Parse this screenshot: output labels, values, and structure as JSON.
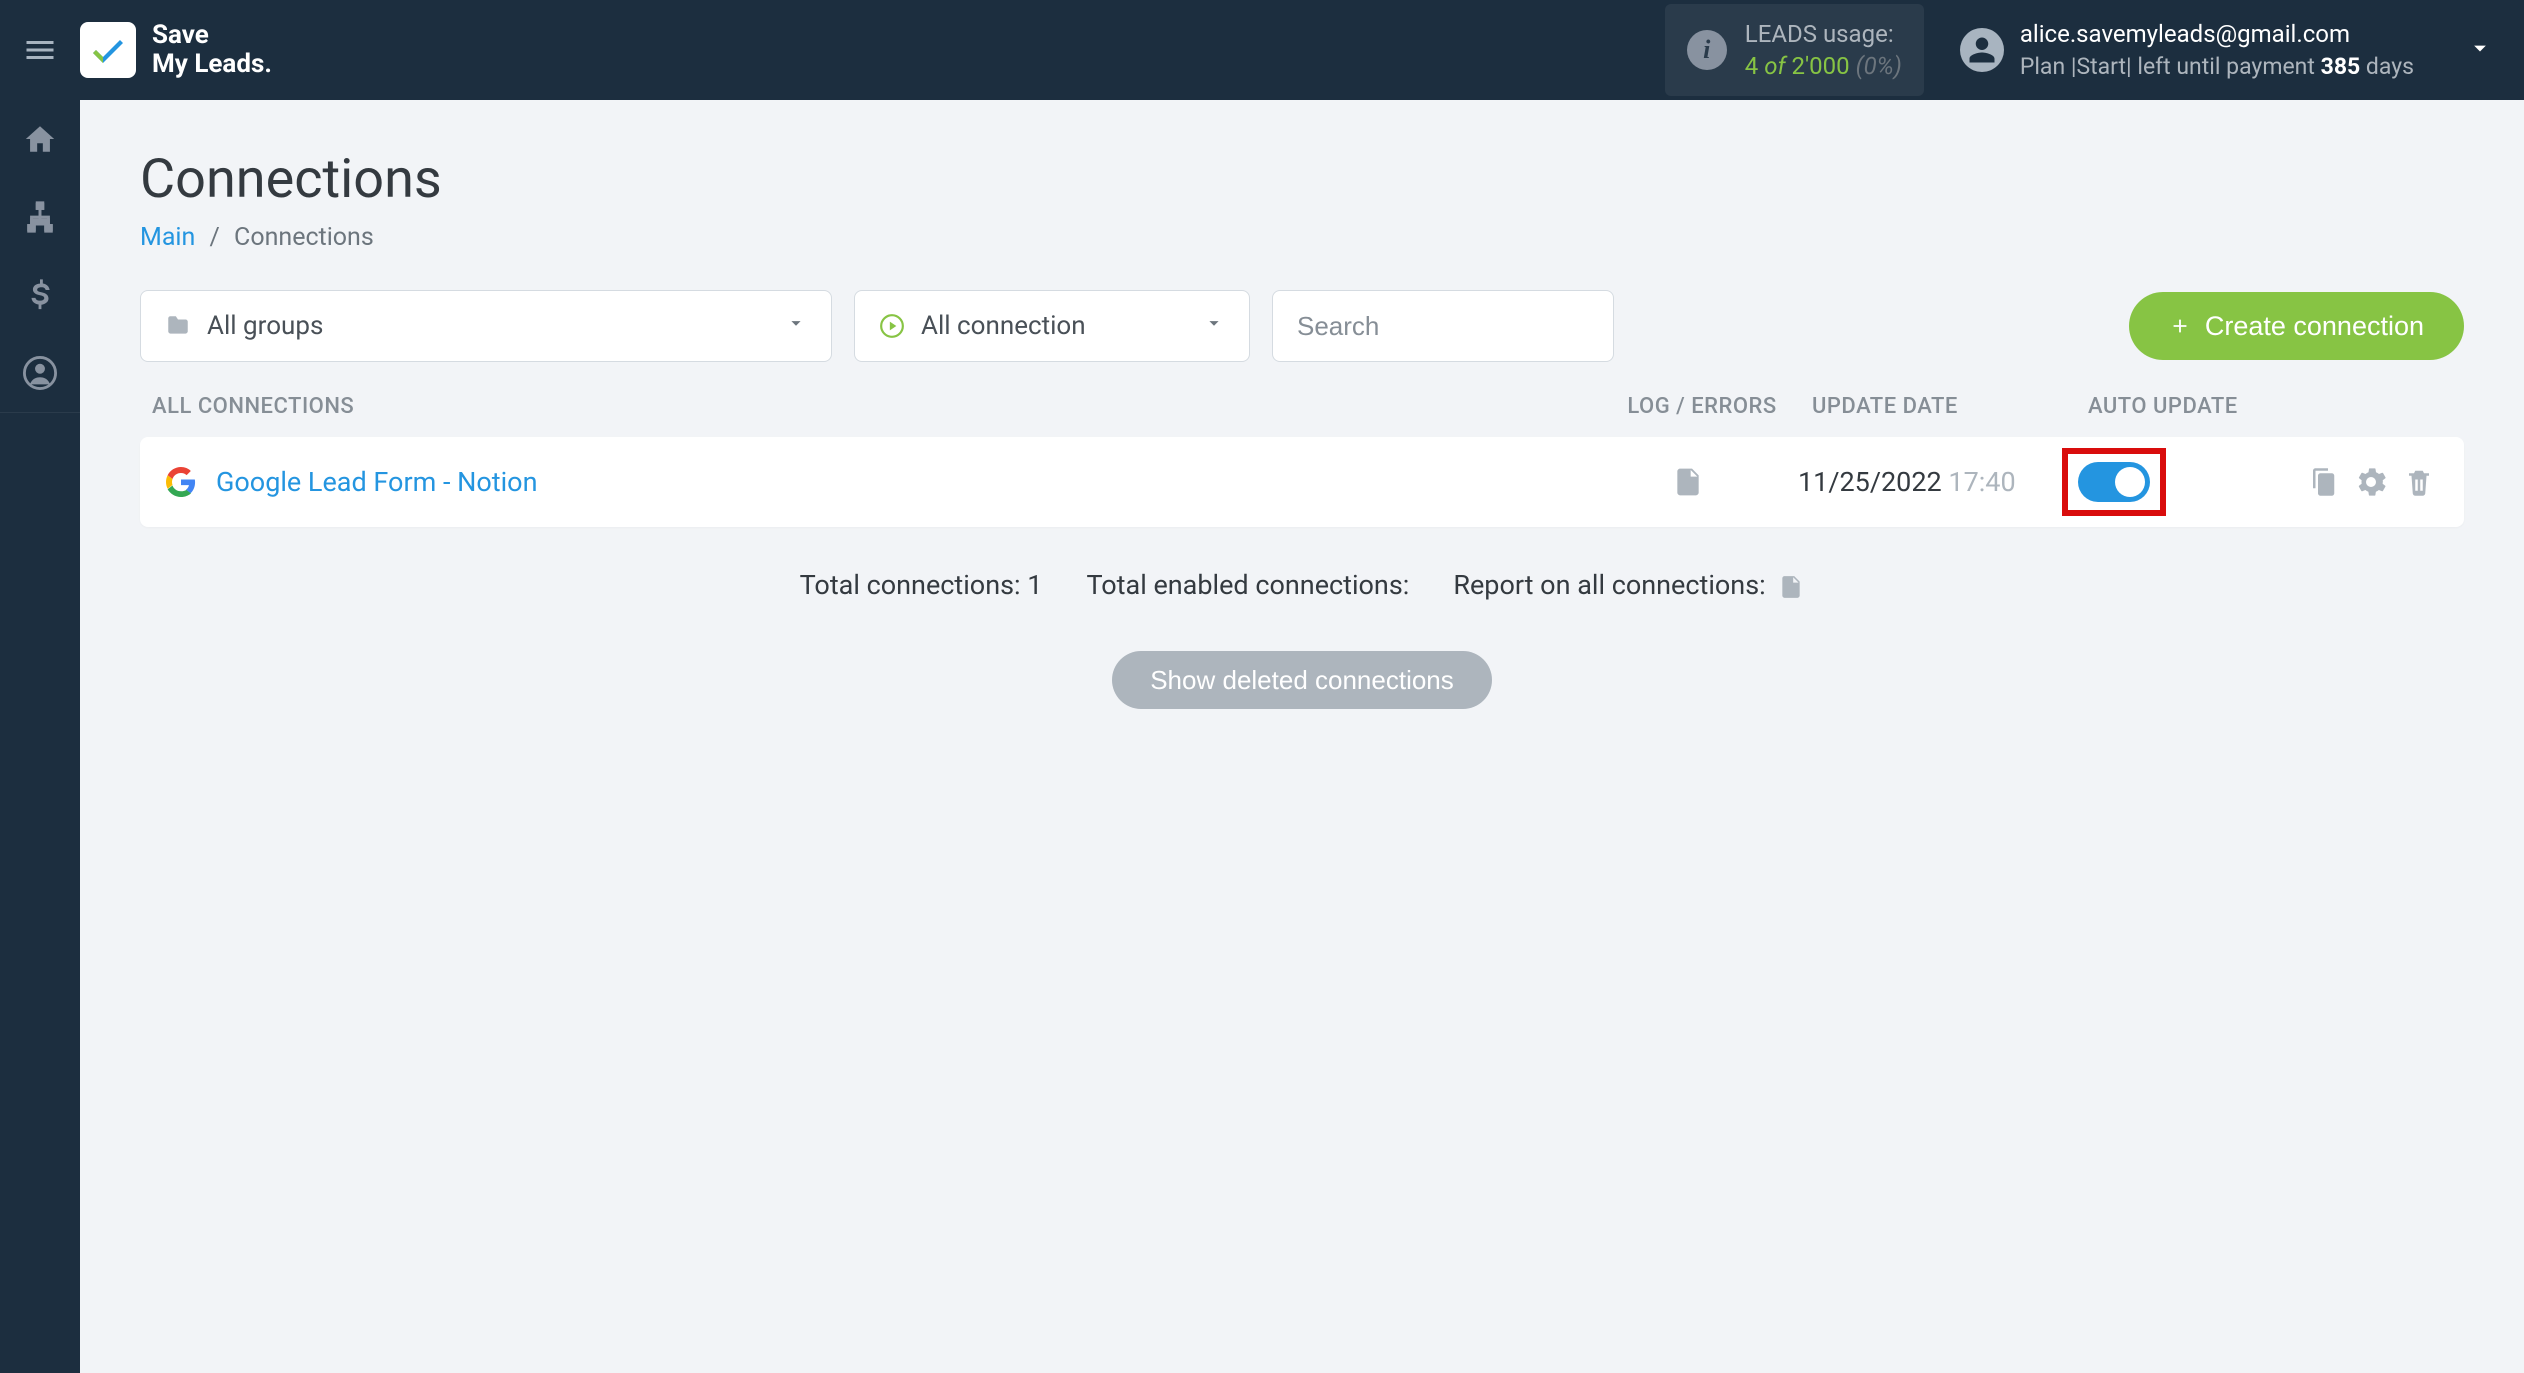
{
  "header": {
    "brand_line1": "Save",
    "brand_line2": "My Leads.",
    "usage_label": "LEADS usage:",
    "usage_current": "4",
    "usage_of": "of",
    "usage_total": "2'000",
    "usage_pct": "(0%)",
    "user_email": "alice.savemyleads@gmail.com",
    "plan_prefix": "Plan |",
    "plan_name": "Start",
    "plan_mid": "| left until payment ",
    "plan_days": "385",
    "plan_days_suffix": " days"
  },
  "page": {
    "title": "Connections",
    "breadcrumb_main": "Main",
    "breadcrumb_current": "Connections"
  },
  "filters": {
    "groups_label": "All groups",
    "status_label": "All connection",
    "search_placeholder": "Search",
    "create_label": "Create connection"
  },
  "columns": {
    "all_connections": "ALL CONNECTIONS",
    "log_errors": "LOG / ERRORS",
    "update_date": "UPDATE DATE",
    "auto_update": "AUTO UPDATE"
  },
  "connections": [
    {
      "name": "Google Lead Form - Notion",
      "date": "11/25/2022",
      "time": "17:40",
      "auto_update": true
    }
  ],
  "stats": {
    "total_label": "Total connections: ",
    "total_value": "1",
    "enabled_label": "Total enabled connections:",
    "report_label": "Report on all connections:"
  },
  "show_deleted_label": "Show deleted connections"
}
